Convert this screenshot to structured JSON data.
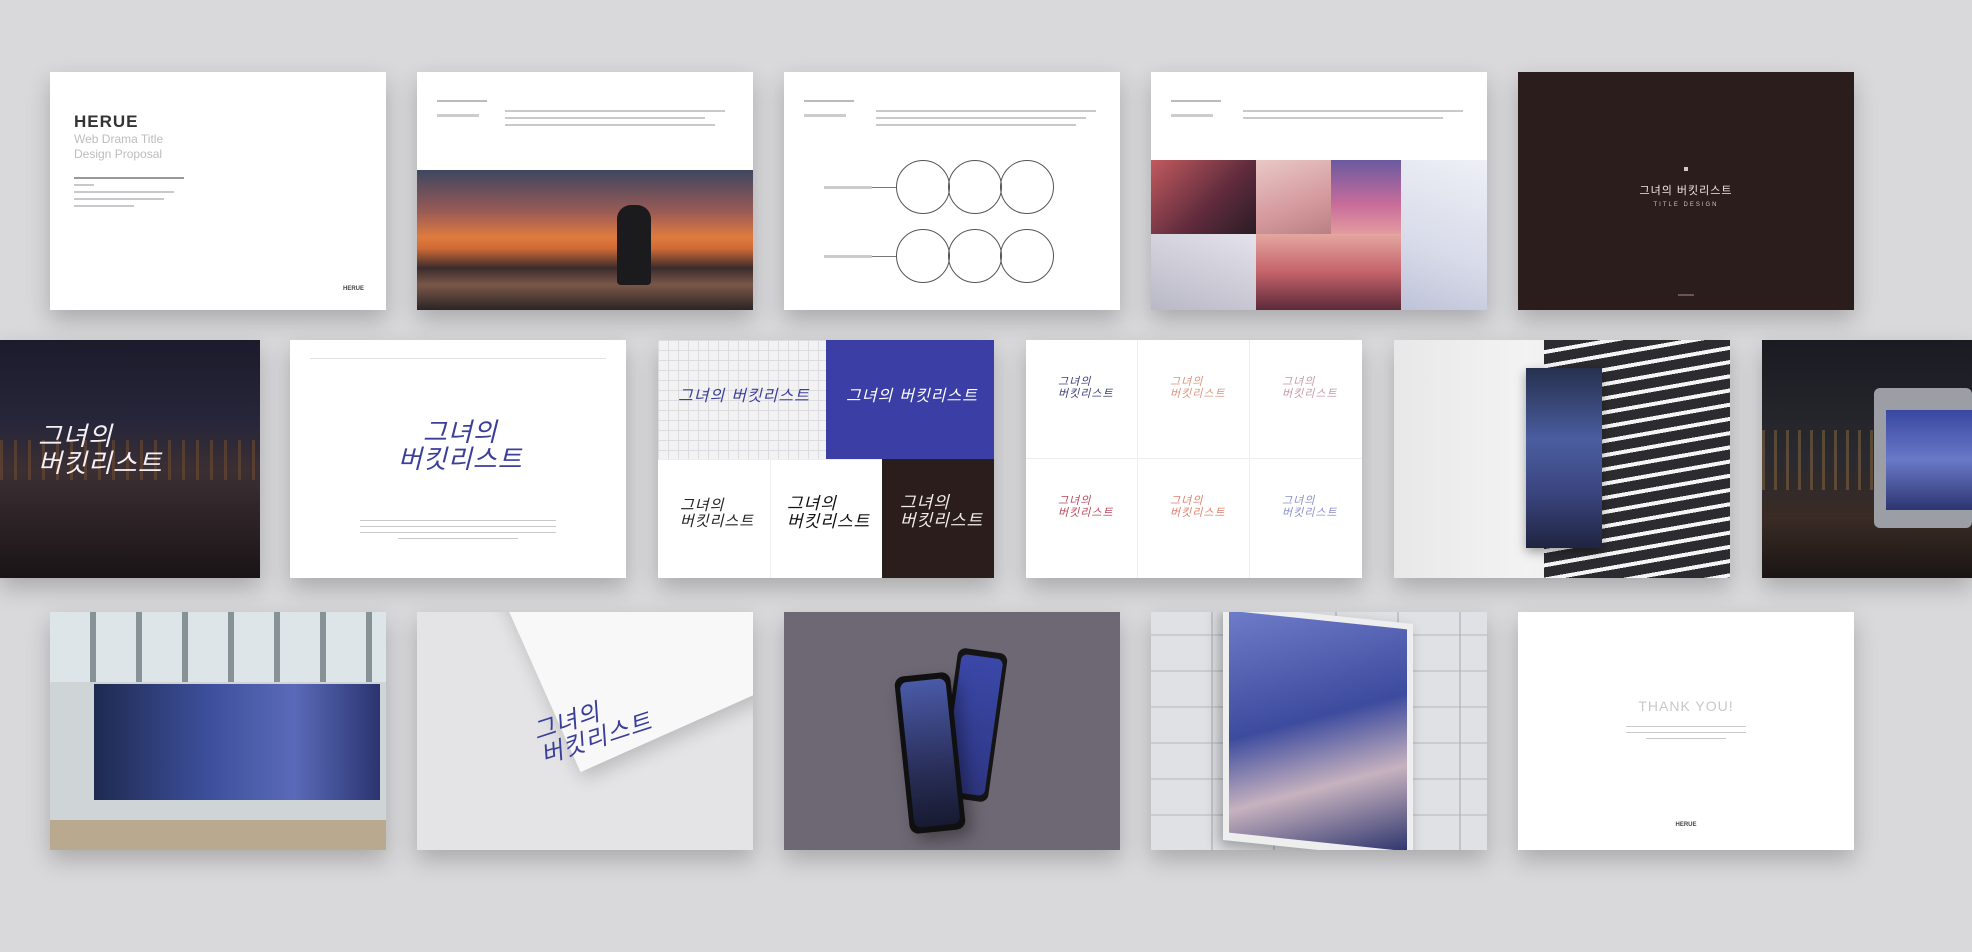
{
  "cover": {
    "brand": "HERUE",
    "title_line1": "Web Drama Title",
    "title_line2": "Design Proposal",
    "footer_logo": "HERUE"
  },
  "title_slide": {
    "korean_title": "그녀의 버킷리스트",
    "subtitle": "TITLE DESIGN"
  },
  "logo": {
    "line1": "그녀의",
    "line2": "버킷리스트",
    "oneline": "그녀의 버킷리스트"
  },
  "closing": {
    "thank_you": "THANK YOU!",
    "footer_logo": "HERUE"
  },
  "colors": {
    "background": "#d9d9db",
    "brand_blue": "#3b3fa5",
    "dark_brown": "#2a1d1c",
    "mockup_gray": "#6e6874"
  }
}
